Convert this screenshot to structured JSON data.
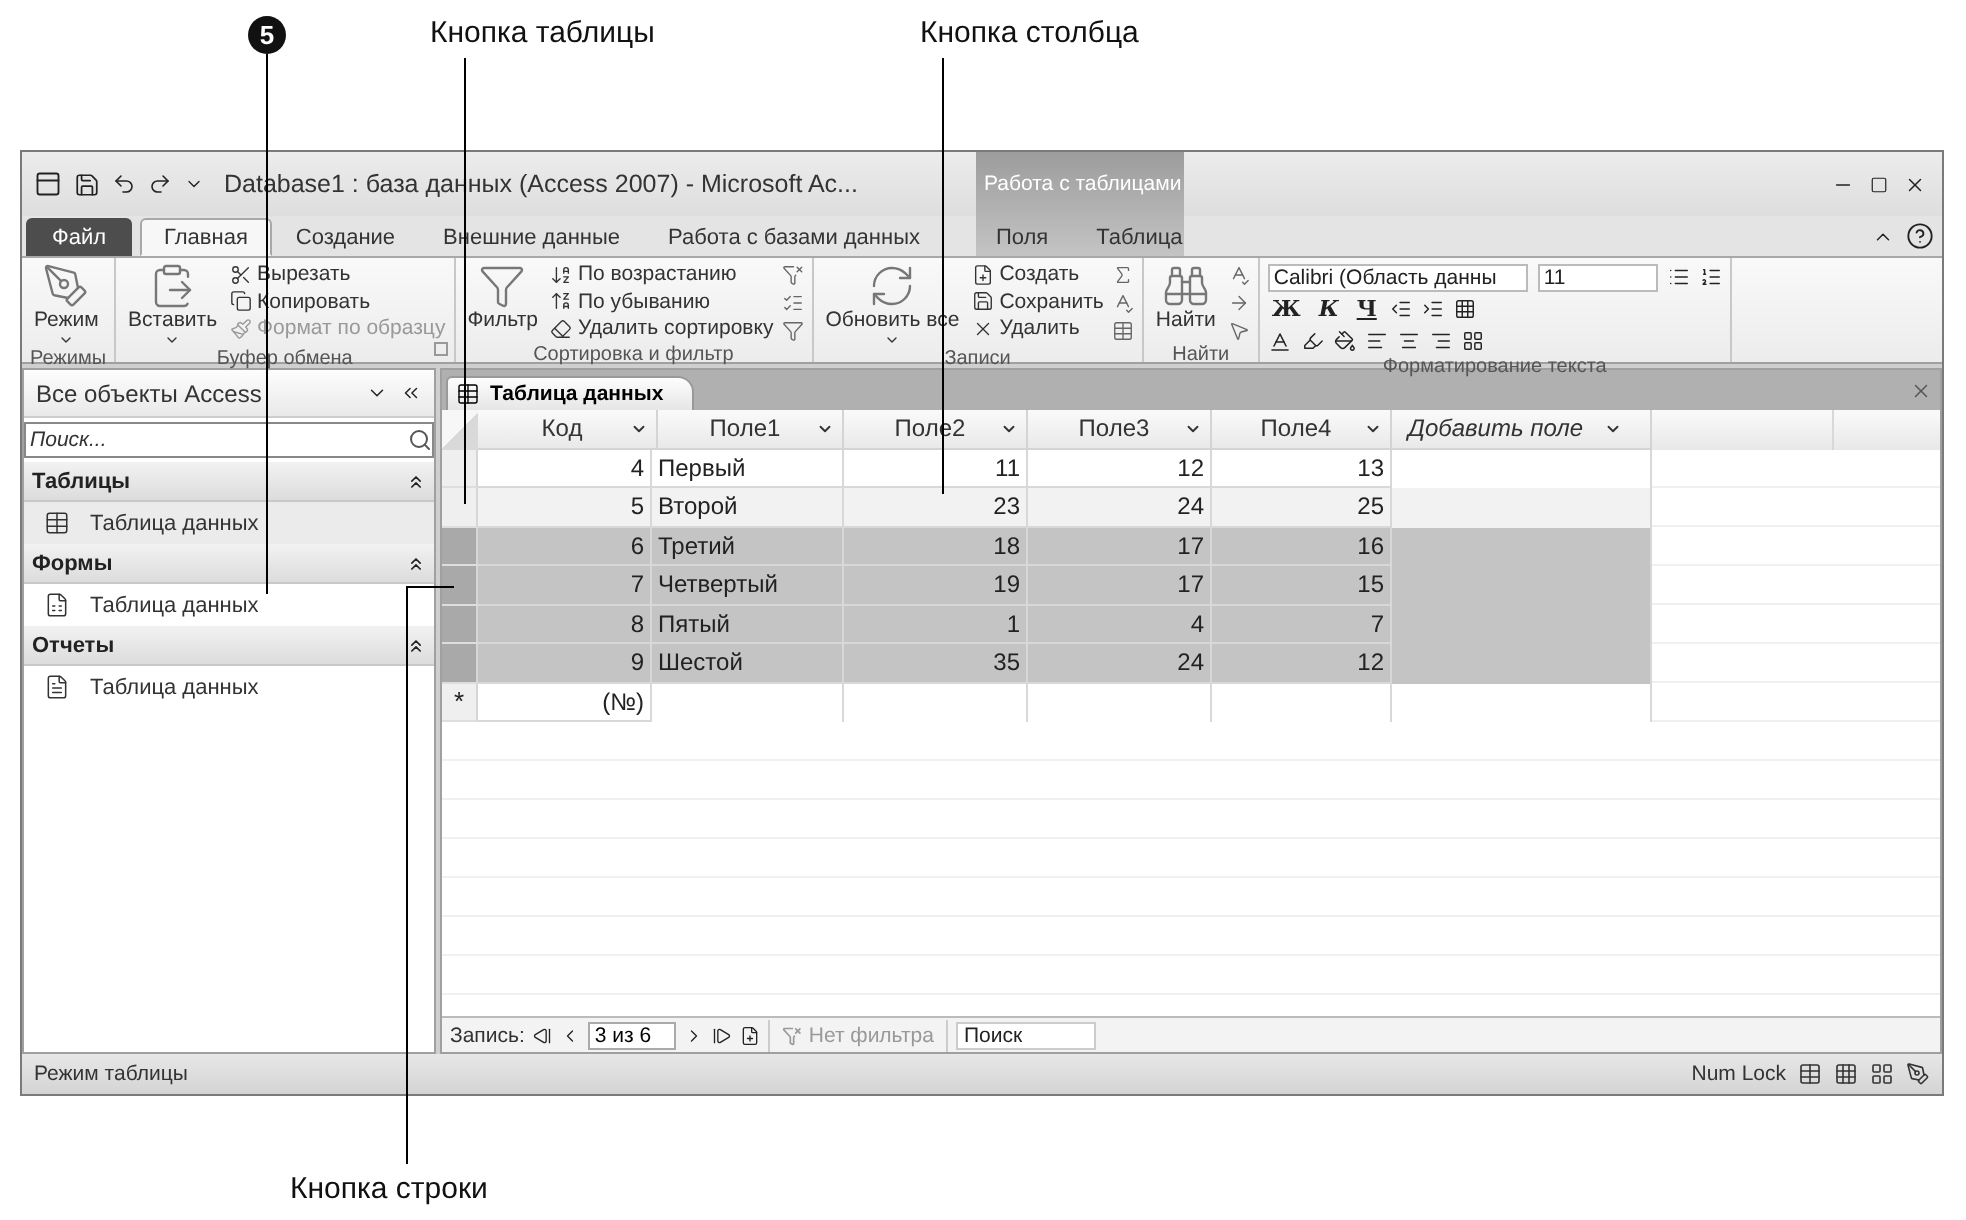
{
  "callouts": {
    "badge": "5",
    "top": [
      "Кнопка таблицы",
      "Кнопка столбца"
    ],
    "bottom": "Кнопка строки"
  },
  "window": {
    "title": "Database1 : база данных (Access 2007)  -  Microsoft Ac...",
    "context_group": "Работа с таблицами"
  },
  "tabs": [
    {
      "label": "Файл",
      "kind": "file",
      "selected": false
    },
    {
      "label": "Главная",
      "kind": "tab",
      "selected": true
    },
    {
      "label": "Создание",
      "kind": "tab",
      "selected": false
    },
    {
      "label": "Внешние данные",
      "kind": "tab",
      "selected": false
    },
    {
      "label": "Работа с базами данных",
      "kind": "tab",
      "selected": false
    },
    {
      "label": "Поля",
      "kind": "context",
      "selected": false
    },
    {
      "label": "Таблица",
      "kind": "context",
      "selected": false
    }
  ],
  "ribbon": [
    {
      "label": "Режимы",
      "large": "Режим",
      "large_dropdown": true,
      "launcher": false
    },
    {
      "label": "Буфер обмена",
      "large": "Вставить",
      "large_dropdown": true,
      "small": [
        {
          "label": "Вырезать",
          "disabled": false
        },
        {
          "label": "Копировать",
          "disabled": false
        },
        {
          "label": "Формат по образцу",
          "disabled": true
        }
      ],
      "launcher": true
    },
    {
      "label": "Сортировка и фильтр",
      "large": "Фильтр",
      "large_dropdown": false,
      "small": [
        {
          "label": "По возрастанию",
          "disabled": false
        },
        {
          "label": "По убыванию",
          "disabled": false
        },
        {
          "label": "Удалить сортировку",
          "disabled": false
        }
      ],
      "launcher": false
    },
    {
      "label": "Записи",
      "large": "Обновить все",
      "large_dropdown": true,
      "small": [
        {
          "label": "Создать",
          "disabled": false
        },
        {
          "label": "Сохранить",
          "disabled": false
        },
        {
          "label": "Удалить",
          "disabled": false
        }
      ],
      "launcher": false
    },
    {
      "label": "Найти",
      "large": "Найти",
      "large_dropdown": false,
      "launcher": false
    }
  ],
  "formatting": {
    "label": "Форматирование текста",
    "font": "Calibri (Область данны",
    "size": "11",
    "style_buttons": [
      "Ж",
      "К",
      "Ч"
    ]
  },
  "nav": {
    "title": "Все объекты Access",
    "search_placeholder": "Поиск...",
    "groups": [
      {
        "label": "Таблицы",
        "items": [
          {
            "label": "Таблица данных",
            "kind": "table",
            "selected": true
          }
        ]
      },
      {
        "label": "Формы",
        "items": [
          {
            "label": "Таблица данных",
            "kind": "form",
            "selected": false
          }
        ]
      },
      {
        "label": "Отчеты",
        "items": [
          {
            "label": "Таблица данных",
            "kind": "report",
            "selected": false
          }
        ]
      }
    ]
  },
  "datasheet": {
    "tab": "Таблица данных",
    "columns": [
      {
        "label": "Код",
        "kind": "number"
      },
      {
        "label": "Поле1",
        "kind": "text"
      },
      {
        "label": "Поле2",
        "kind": "number"
      },
      {
        "label": "Поле3",
        "kind": "number"
      },
      {
        "label": "Поле4",
        "kind": "number"
      },
      {
        "label": "Добавить поле",
        "kind": "add"
      }
    ],
    "rows": [
      {
        "cells": [
          "4",
          "Первый",
          "11",
          "12",
          "13"
        ],
        "selected": false
      },
      {
        "cells": [
          "5",
          "Второй",
          "23",
          "24",
          "25"
        ],
        "selected": false
      },
      {
        "cells": [
          "6",
          "Третий",
          "18",
          "17",
          "16"
        ],
        "selected": true
      },
      {
        "cells": [
          "7",
          "Четвертый",
          "19",
          "17",
          "15"
        ],
        "selected": true
      },
      {
        "cells": [
          "8",
          "Пятый",
          "1",
          "4",
          "7"
        ],
        "selected": true
      },
      {
        "cells": [
          "9",
          "Шестой",
          "35",
          "24",
          "12"
        ],
        "selected": true
      }
    ],
    "new_row": {
      "marker": "*",
      "id": "(№)"
    }
  },
  "record_nav": {
    "label": "Запись:",
    "position": "3 из 6",
    "filter": "Нет фильтра",
    "search_placeholder": "Поиск"
  },
  "status": {
    "mode": "Режим таблицы",
    "num_lock": "Num Lock"
  }
}
